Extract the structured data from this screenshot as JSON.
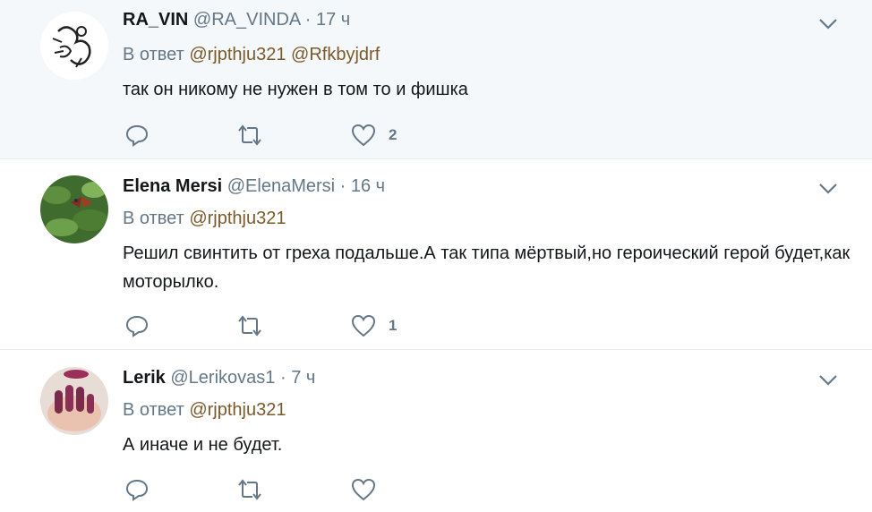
{
  "tweets": [
    {
      "fullname": "RA_VIN",
      "username": "@RA_VINDA",
      "separator": "·",
      "time": "17 ч",
      "reply_prefix": "В ответ",
      "mentions": [
        "@rjpthju321",
        "@Rfkbyjdrf"
      ],
      "text": "так он никому не нужен в том то и фишка",
      "like_count": "2"
    },
    {
      "fullname": "Elena Mersi",
      "username": "@ElenaMersi",
      "separator": "·",
      "time": "16 ч",
      "reply_prefix": "В ответ",
      "mentions": [
        "@rjpthju321"
      ],
      "text": "Решил свинтить от греха подальше.А так типа мёртвый,но героический герой будет,как моторылко.",
      "like_count": "1"
    },
    {
      "fullname": "Lerik",
      "username": "@Lerikovas1",
      "separator": "·",
      "time": "7 ч",
      "reply_prefix": "В ответ",
      "mentions": [
        "@rjpthju321"
      ],
      "text": "А иначе и не будет.",
      "like_count": ""
    }
  ],
  "icons": {
    "reply": "reply-icon",
    "retweet": "retweet-icon",
    "like": "heart-icon",
    "menu": "chevron-down-icon"
  },
  "colors": {
    "highlight_bg": "#f5f8fa",
    "secondary_text": "#657786",
    "mention": "#7a5a2a",
    "divider": "#e6ecf0"
  }
}
